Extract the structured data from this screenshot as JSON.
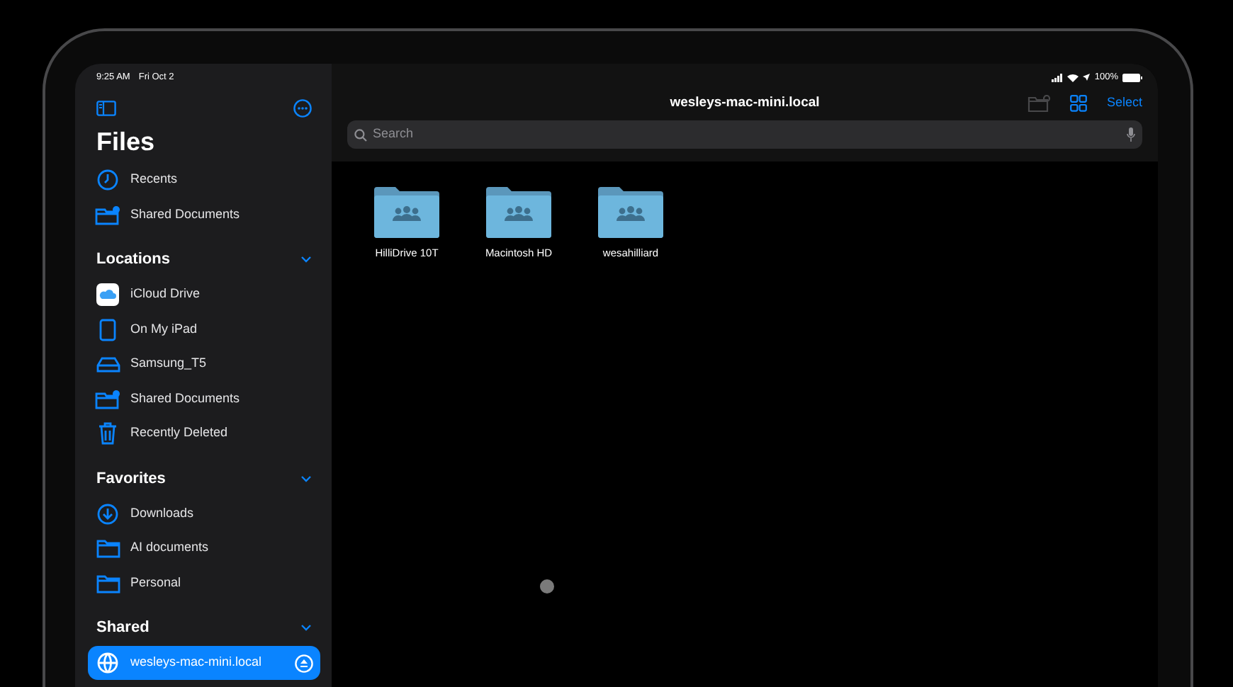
{
  "status_bar": {
    "time": "9:25 AM",
    "date": "Fri Oct 2",
    "battery": "100%"
  },
  "sidebar": {
    "title": "Files",
    "top_items": [
      {
        "label": "Recents",
        "kind": "clock",
        "selected": false
      },
      {
        "label": "Shared Documents",
        "kind": "shared-folder",
        "selected": false
      }
    ],
    "sections": [
      {
        "title": "Locations",
        "expanded": true,
        "items": [
          {
            "label": "iCloud Drive",
            "kind": "cloud",
            "selected": false
          },
          {
            "label": "On My iPad",
            "kind": "ipad",
            "selected": false
          },
          {
            "label": "Samsung_T5",
            "kind": "drive",
            "selected": false
          },
          {
            "label": "Shared Documents",
            "kind": "shared-folder",
            "selected": false
          },
          {
            "label": "Recently Deleted",
            "kind": "trash",
            "selected": false
          }
        ]
      },
      {
        "title": "Favorites",
        "expanded": true,
        "items": [
          {
            "label": "Downloads",
            "kind": "download",
            "selected": false
          },
          {
            "label": "AI documents",
            "kind": "folder",
            "selected": false
          },
          {
            "label": "Personal",
            "kind": "folder",
            "selected": false
          }
        ]
      },
      {
        "title": "Shared",
        "expanded": true,
        "items": [
          {
            "label": "wesleys-mac-mini.local",
            "kind": "globe",
            "selected": true
          }
        ]
      }
    ]
  },
  "main": {
    "title": "wesleys-mac-mini.local",
    "select": "Select",
    "search": {
      "placeholder": "Search"
    },
    "folders": [
      {
        "name": "HilliDrive 10T"
      },
      {
        "name": "Macintosh HD"
      },
      {
        "name": "wesahilliard"
      }
    ]
  }
}
